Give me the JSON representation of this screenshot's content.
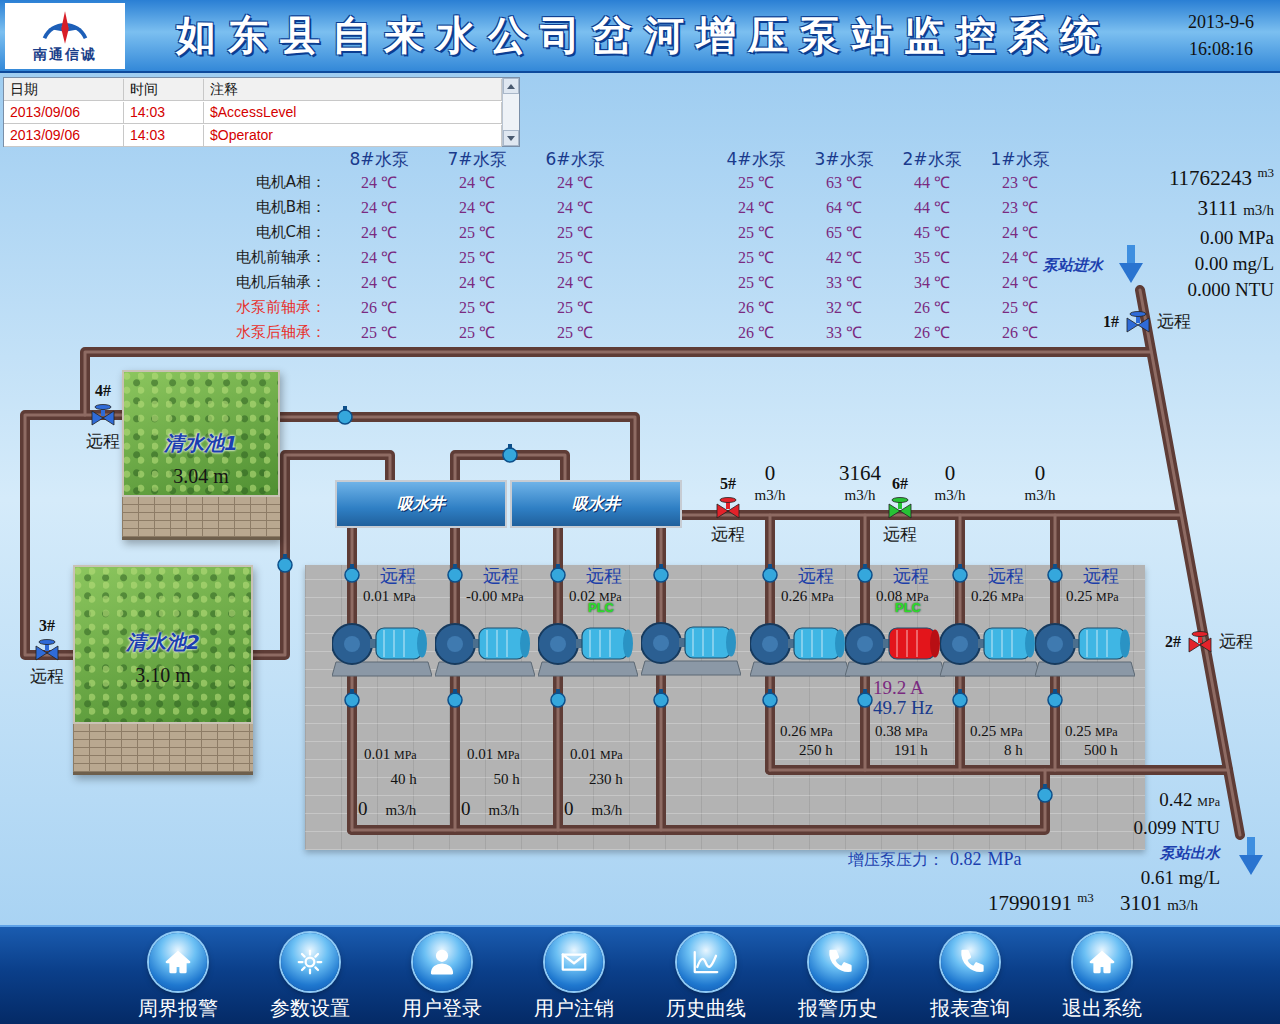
{
  "header": {
    "logo_text": "南通信诚",
    "title": "如东县自来水公司岔河增压泵站监控系统",
    "date": "2013-9-6",
    "time": "16:08:16"
  },
  "event_log": {
    "columns": [
      "日期",
      "时间",
      "注释"
    ],
    "rows": [
      {
        "cells": [
          "2013/09/06",
          "14:03",
          "$AccessLevel"
        ]
      },
      {
        "cells": [
          "2013/09/06",
          "14:03",
          "$Operator"
        ]
      }
    ]
  },
  "temperature_table": {
    "row_labels": [
      {
        "text": "电机A相：",
        "color": "#1e1e1e"
      },
      {
        "text": "电机B相：",
        "color": "#1e1e1e"
      },
      {
        "text": "电机C相：",
        "color": "#1e1e1e"
      },
      {
        "text": "电机前轴承：",
        "color": "#1e1e1e"
      },
      {
        "text": "电机后轴承：",
        "color": "#1e1e1e"
      },
      {
        "text": "水泵前轴承：",
        "color": "#e8302a"
      },
      {
        "text": "水泵后轴承：",
        "color": "#e8302a"
      }
    ],
    "groups": [
      {
        "pumps": [
          {
            "name": "8#水泵",
            "readings": [
              "24 ℃",
              "24 ℃",
              "24 ℃",
              "24 ℃",
              "24 ℃",
              "26 ℃",
              "25 ℃"
            ]
          },
          {
            "name": "7#水泵",
            "readings": [
              "24 ℃",
              "24 ℃",
              "25 ℃",
              "25 ℃",
              "24 ℃",
              "25 ℃",
              "25 ℃"
            ]
          },
          {
            "name": "6#水泵",
            "readings": [
              "24 ℃",
              "24 ℃",
              "25 ℃",
              "25 ℃",
              "24 ℃",
              "25 ℃",
              "25 ℃"
            ]
          }
        ]
      },
      {
        "pumps": [
          {
            "name": "4#水泵",
            "readings": [
              "25 ℃",
              "24 ℃",
              "25 ℃",
              "25 ℃",
              "25 ℃",
              "26 ℃",
              "26 ℃"
            ]
          },
          {
            "name": "3#水泵",
            "readings": [
              "63 ℃",
              "64 ℃",
              "65 ℃",
              "42 ℃",
              "33 ℃",
              "32 ℃",
              "33 ℃"
            ]
          },
          {
            "name": "2#水泵",
            "readings": [
              "44 ℃",
              "44 ℃",
              "45 ℃",
              "35 ℃",
              "34 ℃",
              "26 ℃",
              "26 ℃"
            ]
          },
          {
            "name": "1#水泵",
            "readings": [
              "23 ℃",
              "23 ℃",
              "24 ℃",
              "24 ℃",
              "24 ℃",
              "25 ℃",
              "26 ℃"
            ]
          }
        ]
      }
    ]
  },
  "inlet": {
    "label": "泵站进水",
    "total": "11762243",
    "total_unit": "m3",
    "flow": "3111",
    "flow_unit": "m3/h",
    "readings": [
      "0.00 MPa",
      "0.00 mg/L",
      "0.000 NTU"
    ]
  },
  "pools": [
    {
      "name": "清水池1",
      "depth": "3.04 m"
    },
    {
      "name": "清水池2",
      "depth": "3.10 m"
    }
  ],
  "wells": [
    {
      "name": "吸水井"
    },
    {
      "name": "吸水井"
    }
  ],
  "valves": [
    {
      "number": "1#",
      "mode": "远程",
      "color": "#2f6bd8"
    },
    {
      "number": "2#",
      "mode": "远程",
      "color": "#e3222a"
    },
    {
      "number": "3#",
      "mode": "远程",
      "color": "#2f6bd8"
    },
    {
      "number": "4#",
      "mode": "远程",
      "color": "#2f6bd8"
    },
    {
      "number": "5#",
      "mode": "远程",
      "color": "#e3222a"
    },
    {
      "number": "6#",
      "mode": "远程",
      "color": "#27c235"
    }
  ],
  "booster_flows": [
    {
      "value": "0",
      "unit": "m3/h"
    },
    {
      "value": "3164",
      "unit": "m3/h"
    },
    {
      "value": "0",
      "unit": "m3/h"
    },
    {
      "value": "0",
      "unit": "m3/h"
    }
  ],
  "suction_flows": [
    {
      "value": "0",
      "unit": "m3/h"
    },
    {
      "value": "0",
      "unit": "m3/h"
    },
    {
      "value": "0",
      "unit": "m3/h"
    }
  ],
  "pump_groups": [
    {
      "pumps": [
        {
          "remote": "远程",
          "top_pressure": {
            "value": "0.01",
            "unit": "MPa"
          },
          "bottom_pressure": {
            "value": "0.01",
            "unit": "MPa"
          },
          "hours": "40 h",
          "running": false
        },
        {
          "remote": "远程",
          "top_pressure": {
            "value": "-0.00",
            "unit": "MPa"
          },
          "bottom_pressure": {
            "value": "0.01",
            "unit": "MPa"
          },
          "hours": "50 h",
          "running": false
        },
        {
          "remote": "远程",
          "top_pressure": {
            "value": "0.02",
            "unit": "MPa"
          },
          "plc": "PLC",
          "bottom_pressure": {
            "value": "0.01",
            "unit": "MPa"
          },
          "hours": "230 h",
          "running": false
        },
        {
          "running": false
        }
      ]
    },
    {
      "pumps": [
        {
          "remote": "远程",
          "top_pressure": {
            "value": "0.26",
            "unit": "MPa"
          },
          "bottom_pressure": {
            "value": "0.26",
            "unit": "MPa"
          },
          "hours": "250 h",
          "running": false
        },
        {
          "remote": "远程",
          "top_pressure": {
            "value": "0.08",
            "unit": "MPa"
          },
          "plc": "PLC",
          "current": "19.2 A",
          "frequency": "49.7 Hz",
          "bottom_pressure": {
            "value": "0.38",
            "unit": "MPa"
          },
          "hours": "191 h",
          "running": true
        },
        {
          "remote": "远程",
          "top_pressure": {
            "value": "0.26",
            "unit": "MPa"
          },
          "bottom_pressure": {
            "value": "0.25",
            "unit": "MPa"
          },
          "hours": "8 h",
          "running": false
        },
        {
          "remote": "远程",
          "top_pressure": {
            "value": "0.25",
            "unit": "MPa"
          },
          "bottom_pressure": {
            "value": "0.25",
            "unit": "MPa"
          },
          "hours": "500 h",
          "running": false
        }
      ]
    }
  ],
  "outlet": {
    "pressure": "0.42",
    "pressure_unit": "MPa",
    "turbidity": "0.099 NTU",
    "label": "泵站出水",
    "chlorine": "0.61 mg/L",
    "total": "17990191",
    "total_unit": "m3",
    "flow": "3101",
    "flow_unit": "m3/h"
  },
  "boost_pressure": {
    "label": "增压泵压力：",
    "value": "0.82",
    "unit": "MPa"
  },
  "nav": [
    {
      "label": "周界报警"
    },
    {
      "label": "参数设置"
    },
    {
      "label": "用户登录"
    },
    {
      "label": "用户注销"
    },
    {
      "label": "历史曲线"
    },
    {
      "label": "报警历史"
    },
    {
      "label": "报表查询"
    },
    {
      "label": "退出系统"
    }
  ]
}
